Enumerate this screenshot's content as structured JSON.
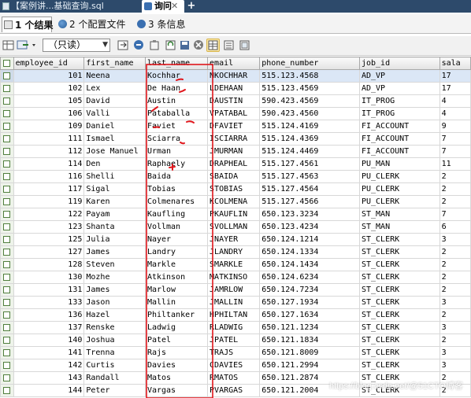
{
  "tabs": [
    {
      "label": "【案例讲...基础查询.sql"
    },
    {
      "label": "询问",
      "close": "✕"
    }
  ],
  "new_tab_glyph": "+",
  "result_tabs": [
    {
      "label": "1 个结果"
    },
    {
      "label": "2 个配置文件"
    },
    {
      "label": "3 条信息"
    }
  ],
  "toolbar": {
    "mode_select": "（只读）",
    "icons": [
      "grid-icon",
      "dropdown-icon",
      "export-icon",
      "copy-icon",
      "paste-icon",
      "refresh-icon",
      "save-icon",
      "delete-icon",
      "grid-view-icon",
      "form-view-icon",
      "text-view-icon"
    ]
  },
  "grid": {
    "columns": [
      "employee_id",
      "first_name",
      "last_name",
      "email",
      "phone_number",
      "job_id",
      "sala"
    ],
    "rows": [
      [
        "101",
        "Neena",
        "Kochhar",
        "NKOCHHAR",
        "515.123.4568",
        "AD_VP",
        "17"
      ],
      [
        "102",
        "Lex",
        "De Haan",
        "LDEHAAN",
        "515.123.4569",
        "AD_VP",
        "17"
      ],
      [
        "105",
        "David",
        "Austin",
        "DAUSTIN",
        "590.423.4569",
        "IT_PROG",
        "4"
      ],
      [
        "106",
        "Valli",
        "Pataballa",
        "VPATABAL",
        "590.423.4560",
        "IT_PROG",
        "4"
      ],
      [
        "109",
        "Daniel",
        "Faviet",
        "DFAVIET",
        "515.124.4169",
        "FI_ACCOUNT",
        "9"
      ],
      [
        "111",
        "Ismael",
        "Sciarra",
        "ISCIARRA",
        "515.124.4369",
        "FI_ACCOUNT",
        "7"
      ],
      [
        "112",
        "Jose Manuel",
        "Urman",
        "JMURMAN",
        "515.124.4469",
        "FI_ACCOUNT",
        "7"
      ],
      [
        "114",
        "Den",
        "Raphaely",
        "DRAPHEAL",
        "515.127.4561",
        "PU_MAN",
        "11"
      ],
      [
        "116",
        "Shelli",
        "Baida",
        "SBAIDA",
        "515.127.4563",
        "PU_CLERK",
        "2"
      ],
      [
        "117",
        "Sigal",
        "Tobias",
        "STOBIAS",
        "515.127.4564",
        "PU_CLERK",
        "2"
      ],
      [
        "119",
        "Karen",
        "Colmenares",
        "KCOLMENA",
        "515.127.4566",
        "PU_CLERK",
        "2"
      ],
      [
        "122",
        "Payam",
        "Kaufling",
        "PKAUFLIN",
        "650.123.3234",
        "ST_MAN",
        "7"
      ],
      [
        "123",
        "Shanta",
        "Vollman",
        "SVOLLMAN",
        "650.123.4234",
        "ST_MAN",
        "6"
      ],
      [
        "125",
        "Julia",
        "Nayer",
        "JNAYER",
        "650.124.1214",
        "ST_CLERK",
        "3"
      ],
      [
        "127",
        "James",
        "Landry",
        "JLANDRY",
        "650.124.1334",
        "ST_CLERK",
        "2"
      ],
      [
        "128",
        "Steven",
        "Markle",
        "SMARKLE",
        "650.124.1434",
        "ST_CLERK",
        "2"
      ],
      [
        "130",
        "Mozhe",
        "Atkinson",
        "MATKINSO",
        "650.124.6234",
        "ST_CLERK",
        "2"
      ],
      [
        "131",
        "James",
        "Marlow",
        "JAMRLOW",
        "650.124.7234",
        "ST_CLERK",
        "2"
      ],
      [
        "133",
        "Jason",
        "Mallin",
        "JMALLIN",
        "650.127.1934",
        "ST_CLERK",
        "3"
      ],
      [
        "136",
        "Hazel",
        "Philtanker",
        "HPHILTAN",
        "650.127.1634",
        "ST_CLERK",
        "2"
      ],
      [
        "137",
        "Renske",
        "Ladwig",
        "RLADWIG",
        "650.121.1234",
        "ST_CLERK",
        "3"
      ],
      [
        "140",
        "Joshua",
        "Patel",
        "JPATEL",
        "650.121.1834",
        "ST_CLERK",
        "2"
      ],
      [
        "141",
        "Trenna",
        "Rajs",
        "TRAJS",
        "650.121.8009",
        "ST_CLERK",
        "3"
      ],
      [
        "142",
        "Curtis",
        "Davies",
        "CDAVIES",
        "650.121.2994",
        "ST_CLERK",
        "3"
      ],
      [
        "143",
        "Randall",
        "Matos",
        "RMATOS",
        "650.121.2874",
        "ST_CLERK",
        "2"
      ],
      [
        "144",
        "Peter",
        "Vargas",
        "PVARGAS",
        "650.121.2004",
        "ST_CLERK",
        "2"
      ]
    ]
  },
  "watermark": "https://blog.csdn.net/@51CTO博客",
  "colors": {
    "title_bar": "#2d4a6b",
    "annotation_red": "#e0151b",
    "selected_row": "#dbe7f6"
  }
}
